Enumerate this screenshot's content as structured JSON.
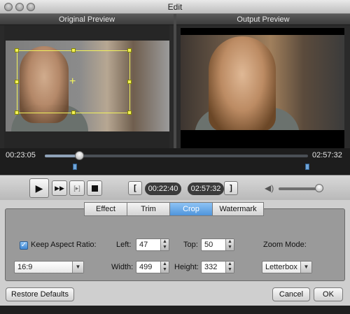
{
  "window": {
    "title": "Edit"
  },
  "preview": {
    "original_label": "Original Preview",
    "output_label": "Output Preview"
  },
  "timeline": {
    "current_time": "00:23:05",
    "total_time": "02:57:32",
    "position_fraction": 0.13
  },
  "controls": {
    "play_icon": "play-icon",
    "next_frame_icon": "next-frame-icon",
    "mark_icon": "mark-icon",
    "stop_icon": "stop-icon",
    "start_bracket": "[",
    "end_bracket": "]",
    "start_time": "00:22:40",
    "end_time": "02:57:32",
    "volume_fraction": 0.9
  },
  "tabs": [
    {
      "label": "Effect",
      "active": false
    },
    {
      "label": "Trim",
      "active": false
    },
    {
      "label": "Crop",
      "active": true
    },
    {
      "label": "Watermark",
      "active": false
    }
  ],
  "crop": {
    "keep_aspect_label": "Keep Aspect Ratio:",
    "keep_aspect_checked": true,
    "aspect_value": "16:9",
    "left_label": "Left:",
    "left_value": "47",
    "top_label": "Top:",
    "top_value": "50",
    "width_label": "Width:",
    "width_value": "499",
    "height_label": "Height:",
    "height_value": "332",
    "zoom_label": "Zoom Mode:",
    "zoom_value": "Letterbox"
  },
  "footer": {
    "restore_label": "Restore Defaults",
    "cancel_label": "Cancel",
    "ok_label": "OK"
  },
  "colors": {
    "crop_box": "#f3f35a",
    "active_tab": "#4f95dc"
  }
}
